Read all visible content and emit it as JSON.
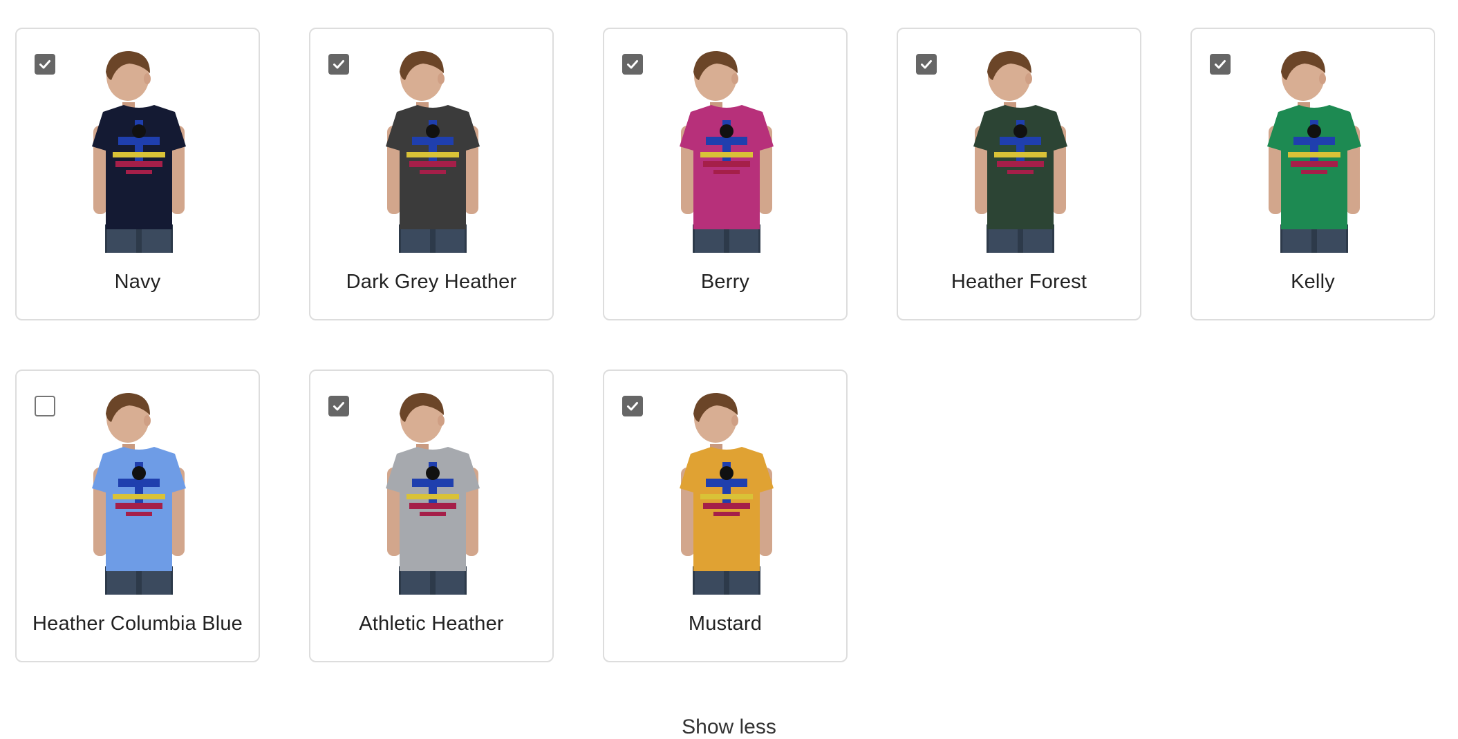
{
  "colors": [
    {
      "name": "Navy",
      "checked": true,
      "shirt": "#141a33"
    },
    {
      "name": "Dark Grey Heather",
      "checked": true,
      "shirt": "#3b3b3b"
    },
    {
      "name": "Berry",
      "checked": true,
      "shirt": "#b7307a"
    },
    {
      "name": "Heather Forest",
      "checked": true,
      "shirt": "#2c4434"
    },
    {
      "name": "Kelly",
      "checked": true,
      "shirt": "#1d8a52"
    },
    {
      "name": "Heather Columbia Blue",
      "checked": false,
      "shirt": "#6e9ce6"
    },
    {
      "name": "Athletic Heather",
      "checked": true,
      "shirt": "#a6a9ae"
    },
    {
      "name": "Mustard",
      "checked": true,
      "shirt": "#e0a233"
    }
  ],
  "footer": {
    "text": "Show less"
  }
}
